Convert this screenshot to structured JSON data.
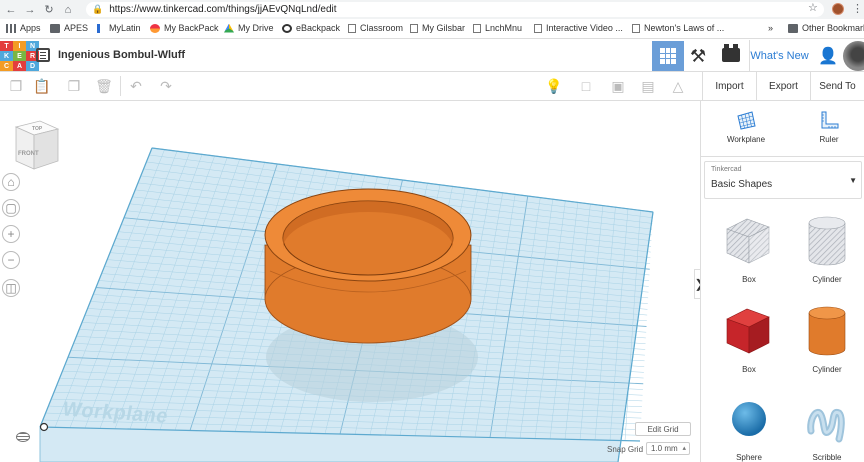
{
  "browser": {
    "url": "https://www.tinkercad.com/things/jjAEvQNqLnd/edit",
    "bookmarks": [
      "Apps",
      "APES",
      "MyLatin",
      "My BackPack",
      "My Drive",
      "eBackpack",
      "Classroom",
      "My Gilsbar",
      "LnchMnu",
      "Interactive Video ...",
      "Newton's Laws of ..."
    ],
    "more": "»",
    "other_bookmarks": "Other Bookmarks"
  },
  "logo": [
    "TIN",
    "KER",
    "CAD"
  ],
  "header": {
    "title": "Ingenious Bombul-Wluff",
    "whats_new": "What's New"
  },
  "toolbar": {
    "import": "Import",
    "export": "Export",
    "send_to": "Send To"
  },
  "viewcube": {
    "top": "TOP",
    "front": "FRONT"
  },
  "workspace": {
    "workplane_label": "Workplane",
    "edit_grid": "Edit Grid",
    "snap_grid_label": "Snap Grid",
    "snap_grid_value": "1.0 mm",
    "object_color": "#e07b2c"
  },
  "panel": {
    "workplane": "Workplane",
    "ruler": "Ruler",
    "library_small": "Tinkercad",
    "library": "Basic Shapes",
    "shapes": [
      {
        "label": "Box",
        "kind": "hole"
      },
      {
        "label": "Cylinder",
        "kind": "hole"
      },
      {
        "label": "Box",
        "kind": "solid"
      },
      {
        "label": "Cylinder",
        "kind": "solid"
      },
      {
        "label": "Sphere",
        "kind": "solid"
      },
      {
        "label": "Scribble",
        "kind": "solid"
      }
    ]
  }
}
